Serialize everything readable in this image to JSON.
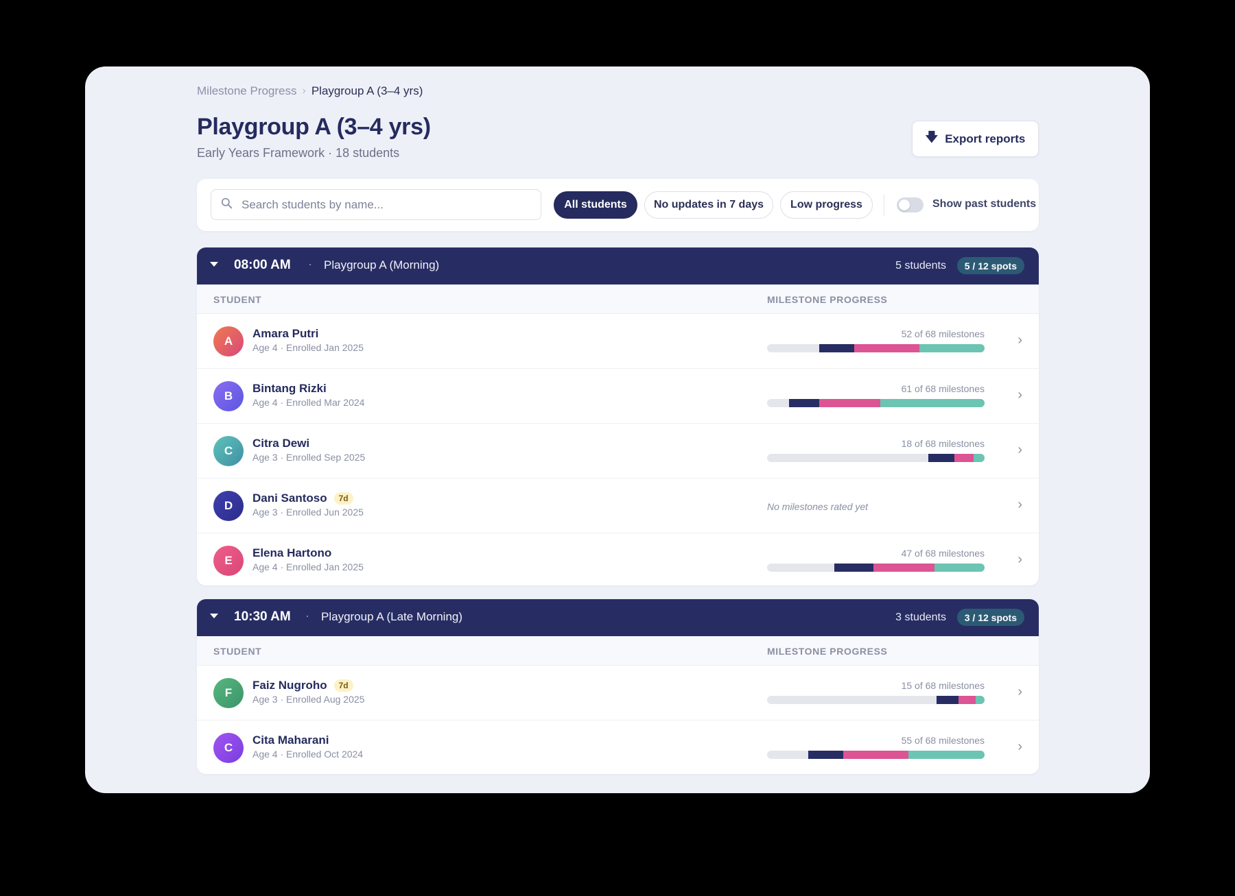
{
  "breadcrumb": {
    "parent": "Milestone Progress",
    "separator": "›",
    "current": "Playgroup A (3–4 yrs)"
  },
  "header": {
    "title": "Playgroup A (3–4 yrs)",
    "subtitle": "Early Years Framework · 18 students",
    "export_label": "Export reports",
    "export_icon": "download-arrow-icon"
  },
  "filters": {
    "search_placeholder": "Search students by name...",
    "search_value": "",
    "chips": [
      {
        "label": "All students",
        "active": true
      },
      {
        "label": "No updates in 7 days",
        "active": false
      },
      {
        "label": "Low progress",
        "active": false
      }
    ],
    "toggle_label": "Show past students",
    "toggle_on": false
  },
  "colors": {
    "navy": "#272d63",
    "pink": "#dc5493",
    "teal": "#6cc4b2",
    "track": "#e5e6eb"
  },
  "columns": {
    "student": "STUDENT",
    "progress": "MILESTONE PROGRESS"
  },
  "groups": [
    {
      "time": "08:00 AM",
      "name": "Playgroup A (Morning)",
      "count": "5 students",
      "spots": "5 / 12 spots",
      "students": [
        {
          "initial": "A",
          "name": "Amara Putri",
          "meta": "Age 4 · Enrolled Jan 2025",
          "badge": "",
          "milestones": "52 of 68 milestones",
          "segments": [
            0.16,
            0.3,
            0.3
          ],
          "avatar": [
            "#ef7a4f",
            "#d9487a"
          ]
        },
        {
          "initial": "B",
          "name": "Bintang Rizki",
          "meta": "Age 4 · Enrolled Mar 2024",
          "badge": "",
          "milestones": "61 of 68 milestones",
          "segments": [
            0.14,
            0.28,
            0.48
          ],
          "avatar": [
            "#8b6cf2",
            "#5b57e0"
          ]
        },
        {
          "initial": "C",
          "name": "Citra Dewi",
          "meta": "Age 3 · Enrolled Sep 2025",
          "badge": "",
          "milestones": "18 of 68 milestones",
          "segments": [
            0.12,
            0.09,
            0.05
          ],
          "avatar": [
            "#5fc3b9",
            "#3f8fa6"
          ]
        },
        {
          "initial": "D",
          "name": "Dani Santoso",
          "meta": "Age 3 · Enrolled Jun 2025",
          "badge": "7d",
          "milestones": "",
          "no_milestones": "No milestones rated yet",
          "segments": [],
          "avatar": [
            "#3f3fb0",
            "#2c2c8a"
          ]
        },
        {
          "initial": "E",
          "name": "Elena Hartono",
          "meta": "Age 4 · Enrolled Jan 2025",
          "badge": "",
          "milestones": "47 of 68 milestones",
          "segments": [
            0.18,
            0.28,
            0.23
          ],
          "avatar": [
            "#ee5d8a",
            "#d94878"
          ]
        }
      ]
    },
    {
      "time": "10:30 AM",
      "name": "Playgroup A (Late Morning)",
      "count": "3 students",
      "spots": "3 / 12 spots",
      "students": [
        {
          "initial": "F",
          "name": "Faiz Nugroho",
          "meta": "Age 3 · Enrolled Aug 2025",
          "badge": "7d",
          "milestones": "15 of 68 milestones",
          "segments": [
            0.1,
            0.08,
            0.04
          ],
          "avatar": [
            "#58b77e",
            "#3a946a"
          ]
        },
        {
          "initial": "C",
          "name": "Cita Maharani",
          "meta": "Age 4 · Enrolled Oct 2024",
          "badge": "",
          "milestones": "55 of 68 milestones",
          "segments": [
            0.16,
            0.3,
            0.35
          ],
          "avatar": [
            "#a055f0",
            "#7a3ee0"
          ]
        }
      ]
    }
  ]
}
